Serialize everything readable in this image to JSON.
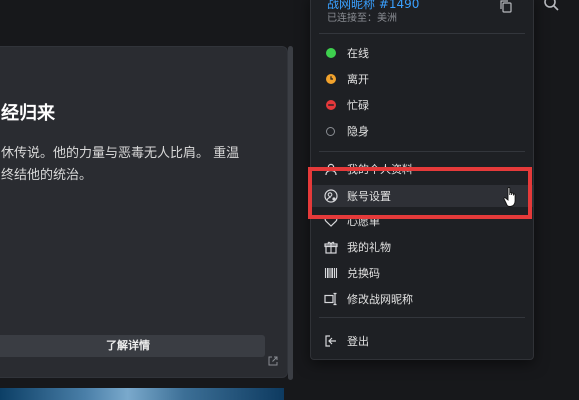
{
  "background_card": {
    "title": "经归来",
    "description_lines": [
      "休传说。他的力量与恶毒无人比肩。 重温",
      "终结他的统治。"
    ],
    "learn_more_label": "了解详情"
  },
  "account_menu": {
    "user_name": "战网昵称 #1490",
    "connection_status": "已连接至：美洲",
    "statuses": [
      {
        "label": "在线",
        "color": "#3ed04e"
      },
      {
        "label": "离开",
        "color": "#f2a22c"
      },
      {
        "label": "忙碌",
        "color": "#e5383b"
      },
      {
        "label": "隐身",
        "color": "#8a8d93"
      }
    ],
    "items": [
      {
        "label": "我的个人资料",
        "icon": "profile-icon"
      },
      {
        "label": "账号设置",
        "icon": "account-settings-icon"
      },
      {
        "label": "心愿单",
        "icon": "heart-icon"
      },
      {
        "label": "我的礼物",
        "icon": "gift-icon"
      },
      {
        "label": "兑换码",
        "icon": "barcode-icon"
      },
      {
        "label": "修改战网昵称",
        "icon": "rename-icon"
      }
    ],
    "logout_label": "登出"
  },
  "colors": {
    "accent_blue": "#3aa0ff",
    "annotation_red": "#e53a3a",
    "menu_background": "#1e2024"
  }
}
